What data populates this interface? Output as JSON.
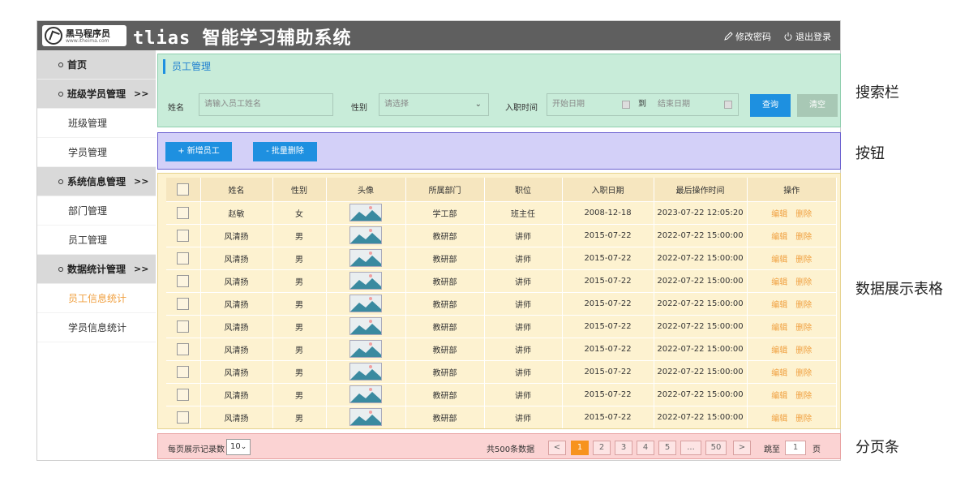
{
  "header": {
    "logo_name": "黑马程序员",
    "logo_url": "www.itheima.com",
    "title": "tlias 智能学习辅助系统",
    "change_password": "修改密码",
    "logout": "退出登录"
  },
  "sidebar": {
    "items": [
      {
        "label": "首页",
        "type": "group"
      },
      {
        "label": "班级学员管理",
        "type": "group",
        "chevron": ">>"
      },
      {
        "label": "班级管理",
        "type": "item"
      },
      {
        "label": "学员管理",
        "type": "item"
      },
      {
        "label": "系统信息管理",
        "type": "group",
        "chevron": ">>"
      },
      {
        "label": "部门管理",
        "type": "item"
      },
      {
        "label": "员工管理",
        "type": "item"
      },
      {
        "label": "数据统计管理",
        "type": "group",
        "chevron": ">>"
      },
      {
        "label": "员工信息统计",
        "type": "item",
        "active": true
      },
      {
        "label": "学员信息统计",
        "type": "item"
      }
    ]
  },
  "search": {
    "breadcrumb": "员工管理",
    "name_label": "姓名",
    "name_placeholder": "请输入员工姓名",
    "gender_label": "性别",
    "gender_placeholder": "请选择",
    "date_label": "入职时间",
    "start_placeholder": "开始日期",
    "to": "到",
    "end_placeholder": "结束日期",
    "query_button": "查询",
    "clear_button": "清空"
  },
  "buttons": {
    "add": "+ 新增员工",
    "batch_delete": "- 批量删除"
  },
  "table": {
    "headers": [
      "姓名",
      "性别",
      "头像",
      "所属部门",
      "职位",
      "入职日期",
      "最后操作时间",
      "操作"
    ],
    "edit_label": "编辑",
    "delete_label": "删除",
    "rows": [
      [
        "赵敏",
        "女",
        "学工部",
        "班主任",
        "2008-12-18",
        "2023-07-22 12:05:20"
      ],
      [
        "风清扬",
        "男",
        "教研部",
        "讲师",
        "2015-07-22",
        "2022-07-22 15:00:00"
      ],
      [
        "风清扬",
        "男",
        "教研部",
        "讲师",
        "2015-07-22",
        "2022-07-22 15:00:00"
      ],
      [
        "风清扬",
        "男",
        "教研部",
        "讲师",
        "2015-07-22",
        "2022-07-22 15:00:00"
      ],
      [
        "风清扬",
        "男",
        "教研部",
        "讲师",
        "2015-07-22",
        "2022-07-22 15:00:00"
      ],
      [
        "风清扬",
        "男",
        "教研部",
        "讲师",
        "2015-07-22",
        "2022-07-22 15:00:00"
      ],
      [
        "风清扬",
        "男",
        "教研部",
        "讲师",
        "2015-07-22",
        "2022-07-22 15:00:00"
      ],
      [
        "风清扬",
        "男",
        "教研部",
        "讲师",
        "2015-07-22",
        "2022-07-22 15:00:00"
      ],
      [
        "风清扬",
        "男",
        "教研部",
        "讲师",
        "2015-07-22",
        "2022-07-22 15:00:00"
      ],
      [
        "风清扬",
        "男",
        "教研部",
        "讲师",
        "2015-07-22",
        "2022-07-22 15:00:00"
      ]
    ]
  },
  "pager": {
    "per_page_label": "每页展示记录数",
    "per_page_value": "10",
    "total": "共500条数据",
    "prev": "<",
    "pages": [
      "1",
      "2",
      "3",
      "4",
      "5",
      "...",
      "50"
    ],
    "next": ">",
    "jump_label": "跳至",
    "jump_value": "1",
    "page_unit": "页"
  },
  "annotations": {
    "search": "搜索栏",
    "buttons": "按钮",
    "table": "数据展示表格",
    "pager": "分页条"
  },
  "colors": {
    "header_bg": "#5f5f5f",
    "accent_orange": "#f7931e",
    "primary_blue": "#1e90e0",
    "search_bg": "#c8ecd9",
    "button_bg": "#d3d0f8",
    "table_bg": "#fdf2d0",
    "pager_bg": "#fbd3d3"
  }
}
